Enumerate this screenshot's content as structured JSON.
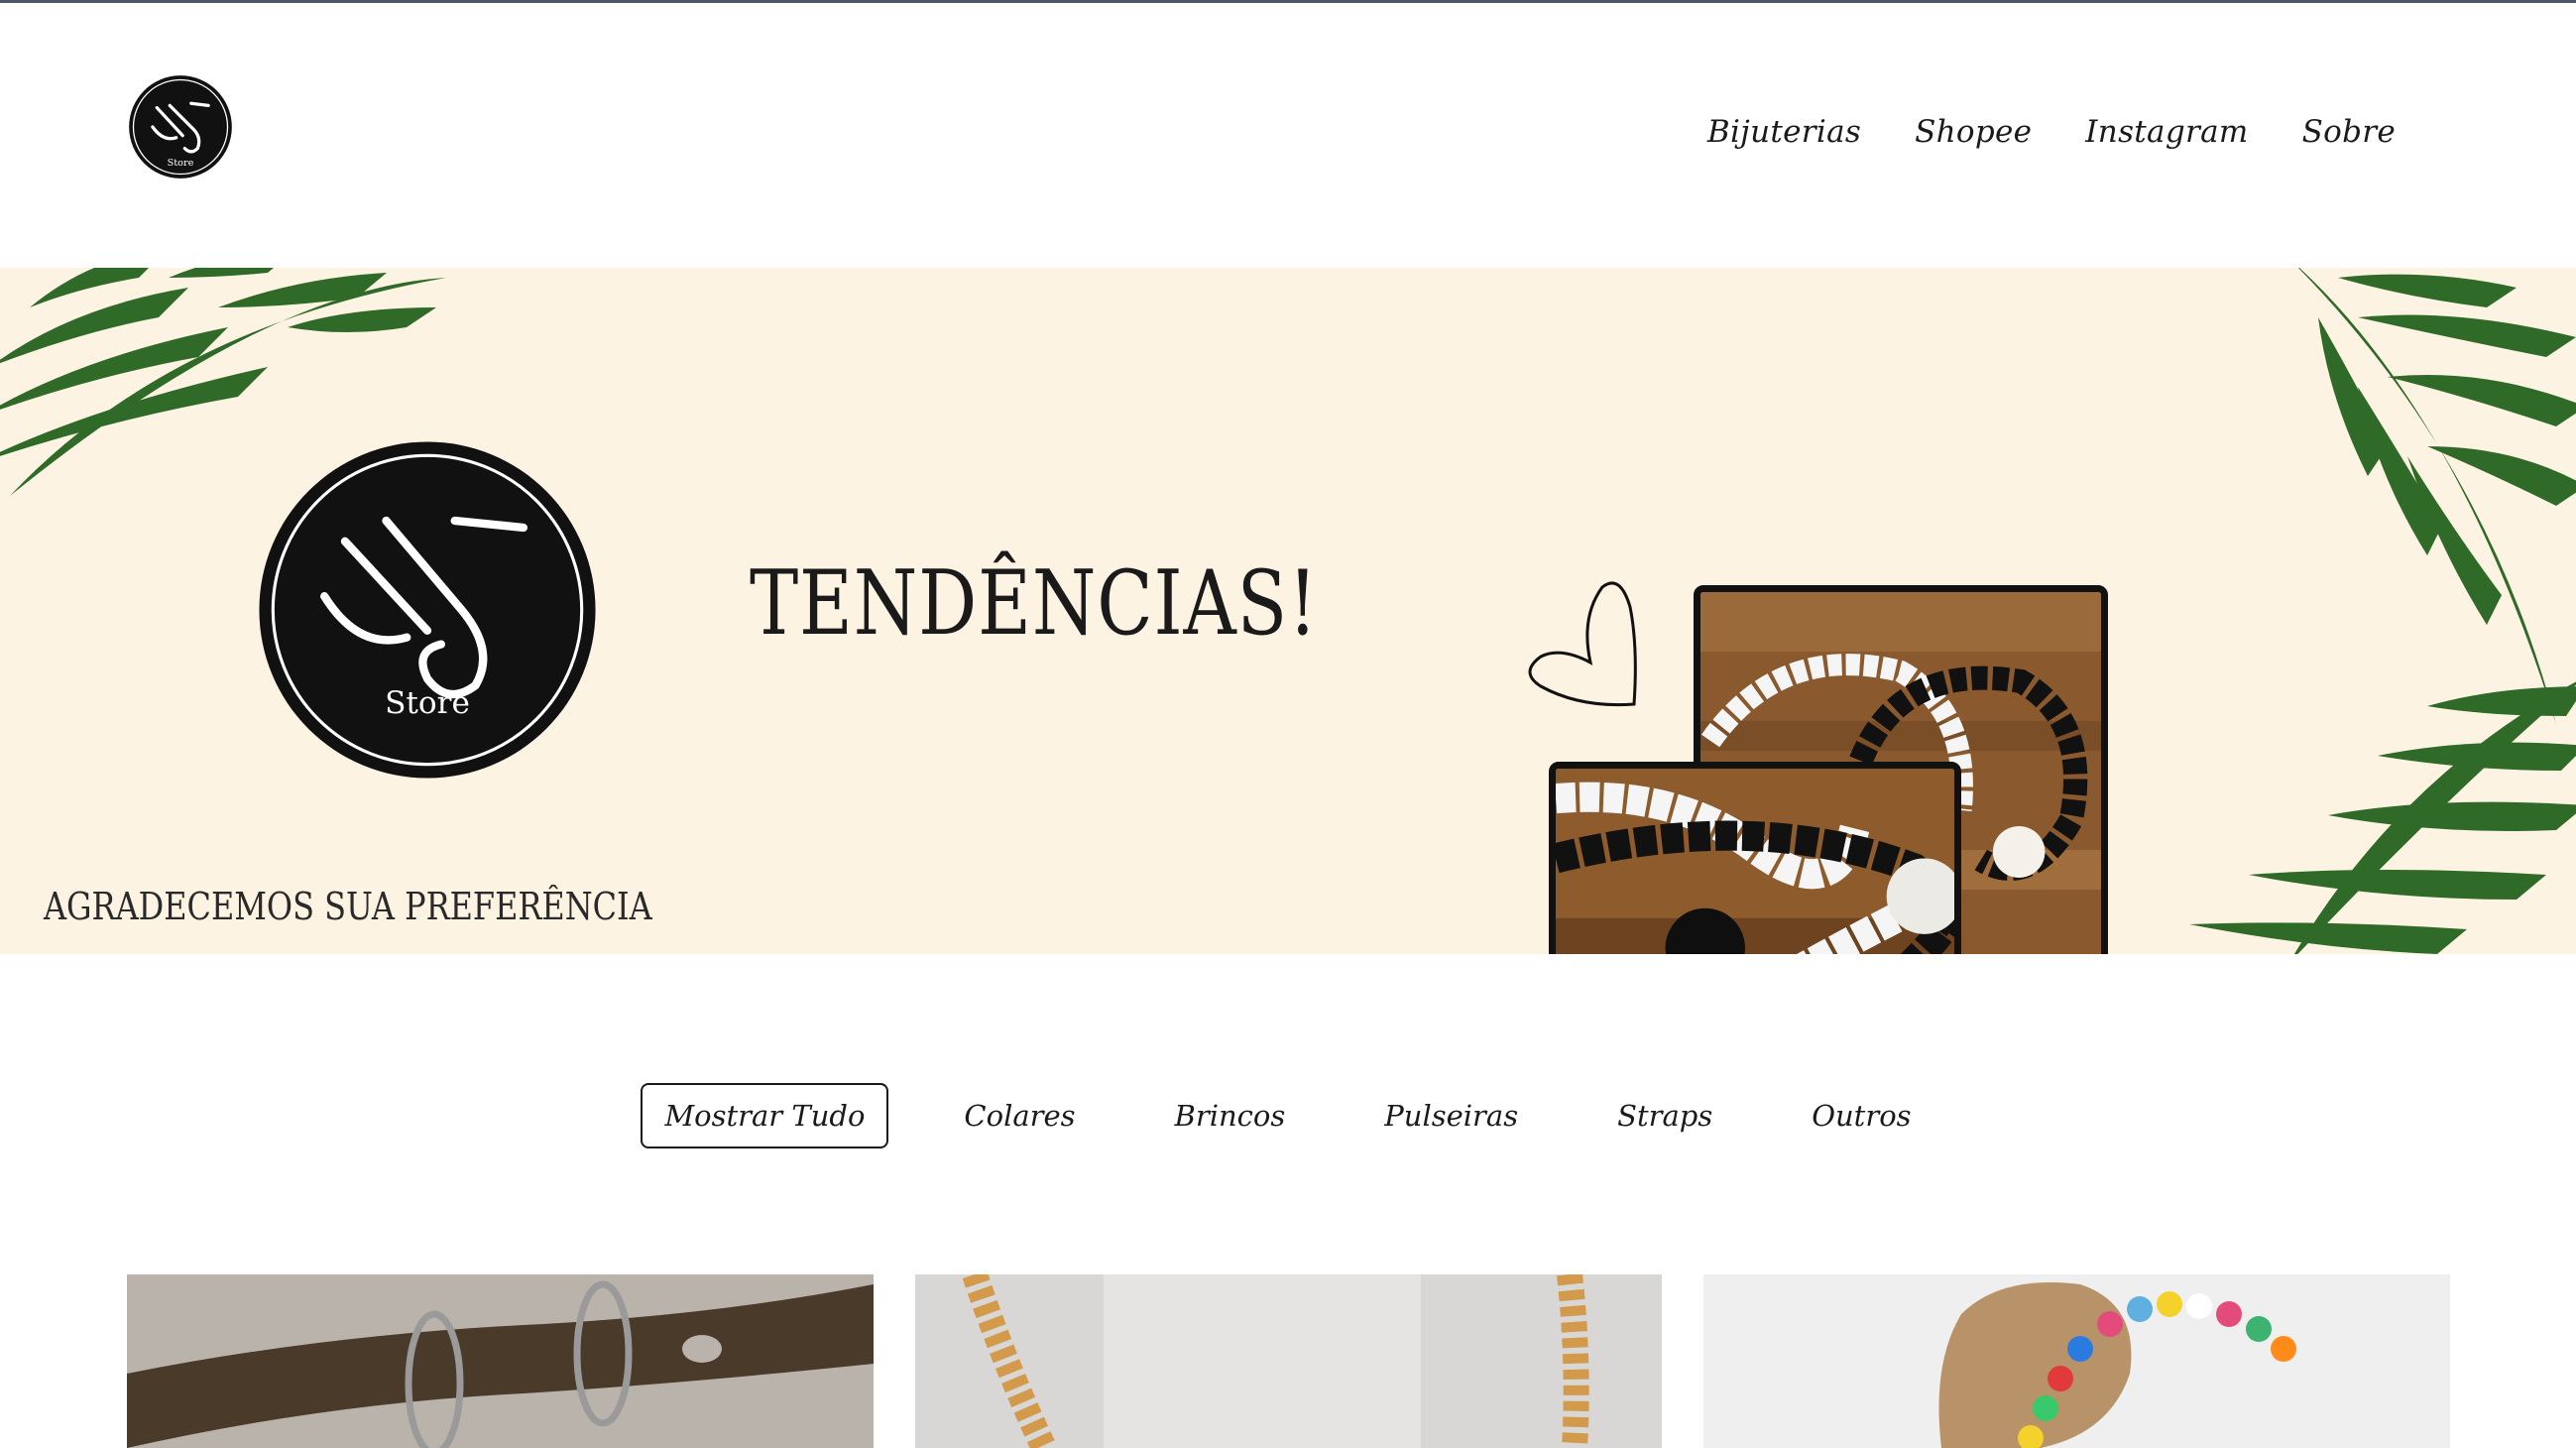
{
  "brand": {
    "logo_initials": "LJ",
    "logo_store": "Store"
  },
  "nav": {
    "items": [
      {
        "label": "Bijuterias"
      },
      {
        "label": "Shopee"
      },
      {
        "label": "Instagram"
      },
      {
        "label": "Sobre"
      }
    ]
  },
  "banner": {
    "title": "TENDÊNCIAS!",
    "subtitle": "AGRADECEMOS SUA PREFERÊNCIA"
  },
  "filters": {
    "active": "Mostrar Tudo",
    "items": [
      {
        "label": "Mostrar Tudo"
      },
      {
        "label": "Colares"
      },
      {
        "label": "Brincos"
      },
      {
        "label": "Pulseiras"
      },
      {
        "label": "Straps"
      },
      {
        "label": "Outros"
      }
    ]
  },
  "colors": {
    "banner_bg": "#fcf3e3",
    "leaf": "#2f6a28",
    "text": "#1a1a1a"
  },
  "icons": [
    "lj-store-logo",
    "palm-leaf",
    "heart-outline"
  ]
}
